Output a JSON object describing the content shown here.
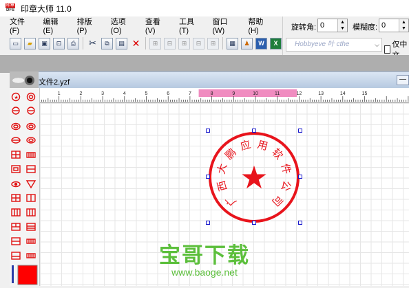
{
  "app": {
    "logo_top": "印章",
    "logo_bottom": "DFS",
    "title": "印章大师 11.0"
  },
  "menu": [
    "文件(F)",
    "编辑(E)",
    "排版(P)",
    "选项(O)",
    "查看(V)",
    "工具(T)",
    "窗口(W)",
    "帮助(H)"
  ],
  "toolbar": {
    "icons": [
      "new-file-icon",
      "open-folder-icon",
      "save-icon",
      "print-preview-icon",
      "print-icon",
      "cut-icon",
      "copy-icon",
      "paste-icon",
      "delete-icon",
      "align-icon",
      "align-icon",
      "align-icon",
      "align-icon",
      "align-icon",
      "image-icon",
      "stamp-icon",
      "word-icon",
      "excel-icon"
    ],
    "word_label": "W",
    "excel_label": "X"
  },
  "props": {
    "rotation_label": "旋转角:",
    "rotation_value": "0",
    "blur_label": "模糊度:",
    "blur_value": "0",
    "font_preview": "Hobbyeve 叶 cthe",
    "chinese_only_label": "仅中文",
    "chinese_only_checked": false
  },
  "document": {
    "title": "文件2.yzf",
    "min_button": "—"
  },
  "ruler": {
    "labels": [
      "1",
      "2",
      "3",
      "4",
      "5",
      "6",
      "7",
      "8",
      "9",
      "10",
      "11",
      "12",
      "13",
      "14",
      "15"
    ],
    "highlight_from": 8,
    "highlight_to": 12,
    "highlight_color": "#f08cc0"
  },
  "stamp": {
    "color": "#e8141c",
    "text": "广西大鹏应用软件公司",
    "center_symbol": "★"
  },
  "shapes_panel": {
    "items": [
      "circle-star-shape",
      "circle-shape",
      "ellipse-shape",
      "double-ellipse-shape",
      "oval-shape",
      "oval-double-shape",
      "ellipse-wide-shape",
      "ellipse-hollow-shape",
      "rect-grid-shape",
      "rect-strip-shape",
      "rect-shape",
      "rect-double-shape",
      "eye-shape",
      "triangle-shape",
      "grid-4-shape",
      "grid-split-shape",
      "grid-3-shape",
      "grid-bar-shape",
      "grid-tall-shape",
      "grid-wide-shape",
      "grid-rows-shape",
      "strip-shape",
      "grid-bottom-shape",
      "strip-2-shape"
    ],
    "color_swatch": "#ff0000"
  },
  "watermark": {
    "cn": "宝哥下载",
    "url": "www.baoge.net"
  }
}
